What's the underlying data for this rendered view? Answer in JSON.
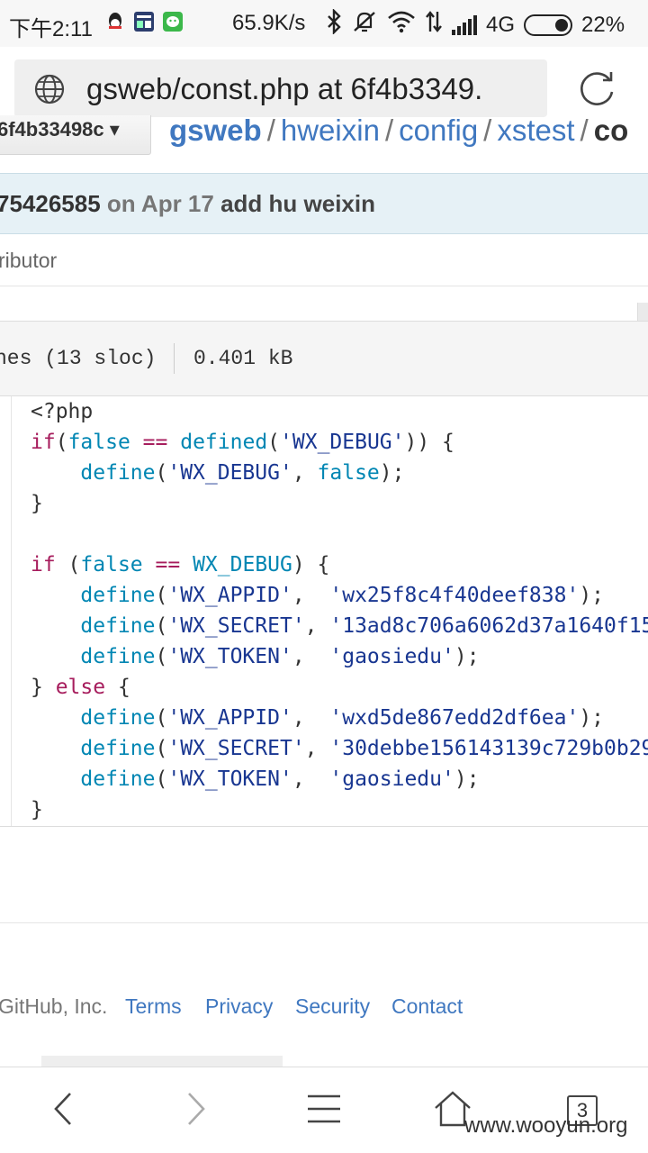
{
  "status_bar": {
    "time": "下午2:11",
    "net_speed": "65.9K/s",
    "network": "4G",
    "battery_pct": "22%",
    "icons": [
      "qq-icon",
      "app-icon",
      "wechat-icon",
      "bluetooth-icon",
      "mute-icon",
      "wifi-icon",
      "data-arrows-icon",
      "signal-icon",
      "battery-icon"
    ]
  },
  "address_bar": {
    "url": "gsweb/const.php at 6f4b3349."
  },
  "repo": {
    "branch": "6f4b33498c ▾",
    "breadcrumb": {
      "root": "gsweb",
      "parts": [
        "hweixin",
        "config",
        "xstest"
      ],
      "current": "co"
    }
  },
  "commit": {
    "sha": "75426585",
    "date": " on Apr 17 ",
    "message": "add hu weixin"
  },
  "contributors": "ributor",
  "file_info": {
    "lines": "nes (13 sloc)",
    "size": "0.401 kB"
  },
  "footer": {
    "copyright": "GitHub, Inc.",
    "links": [
      "Terms",
      "Privacy",
      "Security",
      "Contact"
    ]
  },
  "nav": {
    "tabs_count": "3"
  },
  "watermark": "www.wooyun.org",
  "colors": {
    "link": "#4078c0",
    "keyword": "#a71d5d",
    "function": "#0086b3",
    "string": "#183691",
    "commit_bg": "#e6f1f6"
  }
}
